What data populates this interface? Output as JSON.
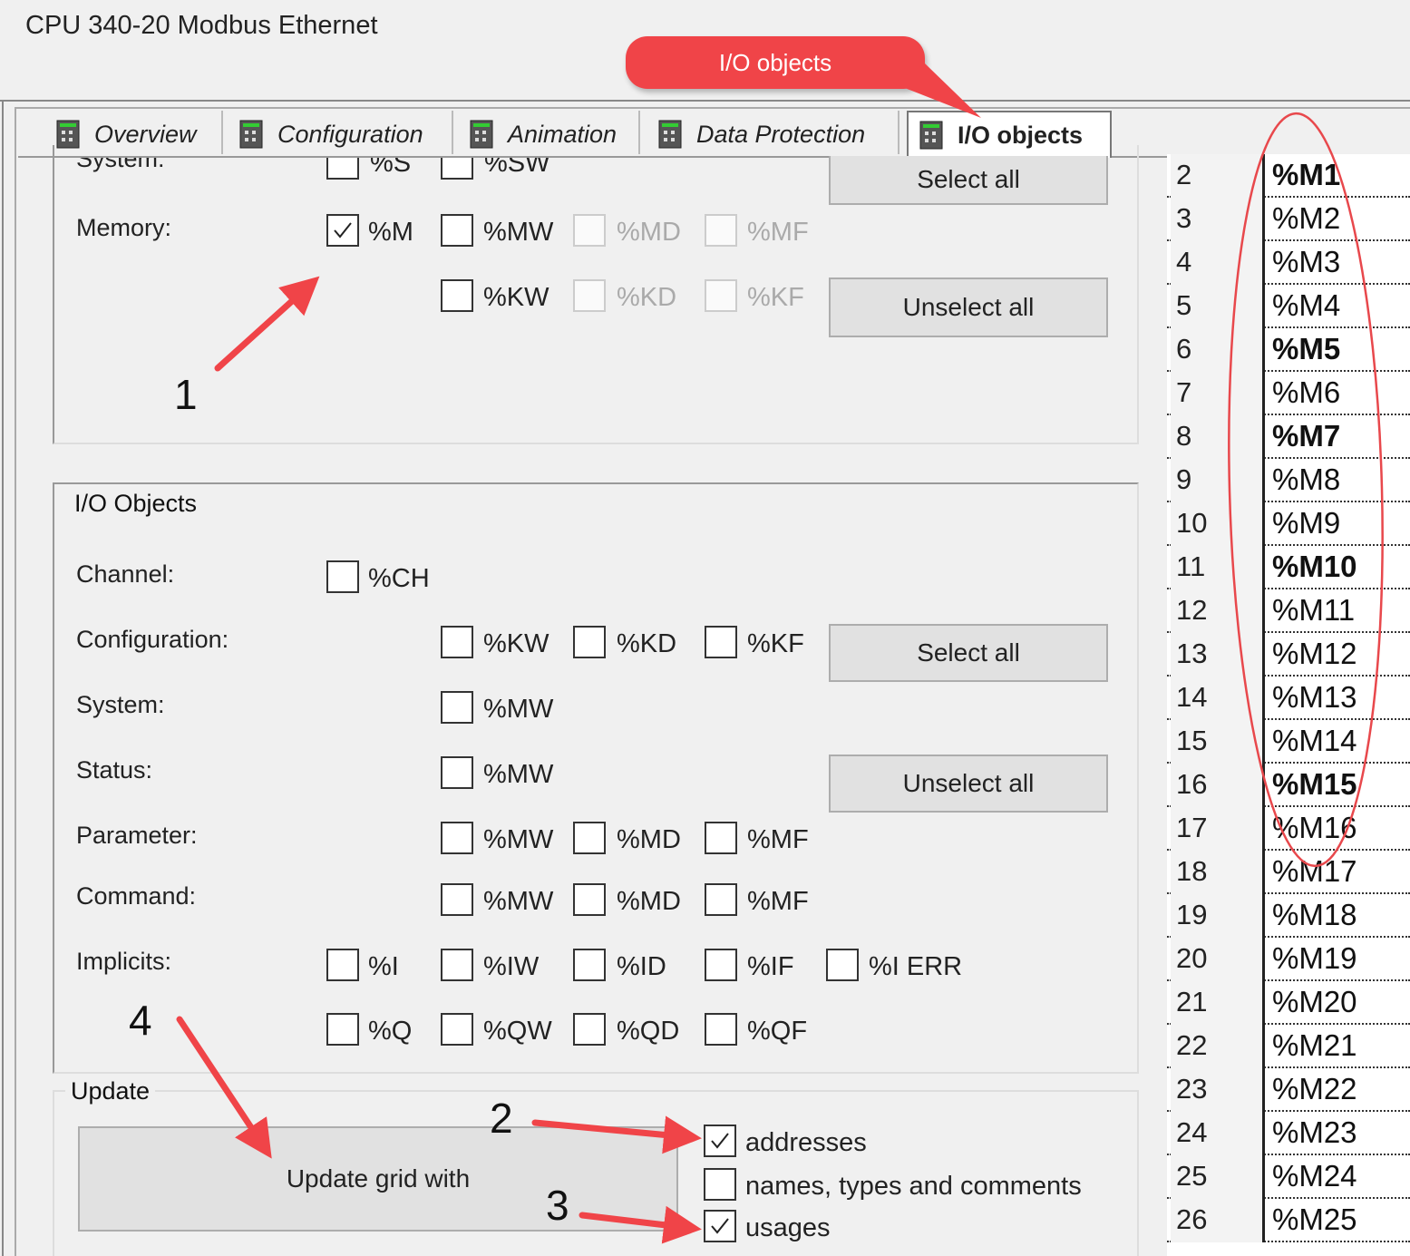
{
  "window": {
    "title": "CPU 340-20 Modbus Ethernet"
  },
  "tabs": [
    {
      "label": "Overview",
      "active": false
    },
    {
      "label": "Configuration",
      "active": false
    },
    {
      "label": "Animation",
      "active": false
    },
    {
      "label": "Data Protection",
      "active": false
    },
    {
      "label": "I/O objects",
      "active": true
    }
  ],
  "callout": {
    "text": "I/O objects"
  },
  "memory_group": {
    "system_label": "System:",
    "system_items": [
      {
        "label": "%S",
        "checked": false
      },
      {
        "label": "%SW",
        "checked": false
      }
    ],
    "memory_label": "Memory:",
    "memory_items": [
      {
        "label": "%M",
        "checked": true,
        "enabled": true
      },
      {
        "label": "%MW",
        "checked": false,
        "enabled": true
      },
      {
        "label": "%MD",
        "checked": false,
        "enabled": false
      },
      {
        "label": "%MF",
        "checked": false,
        "enabled": false
      },
      {
        "label": "%KW",
        "checked": false,
        "enabled": true
      },
      {
        "label": "%KD",
        "checked": false,
        "enabled": false
      },
      {
        "label": "%KF",
        "checked": false,
        "enabled": false
      }
    ],
    "select_all": "Select all",
    "unselect_all": "Unselect all"
  },
  "io_group": {
    "title": "I/O Objects",
    "rows": [
      {
        "label": "Channel:",
        "items": [
          "%CH"
        ]
      },
      {
        "label": "Configuration:",
        "items": [
          "%KW",
          "%KD",
          "%KF"
        ]
      },
      {
        "label": "System:",
        "items": [
          "%MW"
        ]
      },
      {
        "label": "Status:",
        "items": [
          "%MW"
        ]
      },
      {
        "label": "Parameter:",
        "items": [
          "%MW",
          "%MD",
          "%MF"
        ]
      },
      {
        "label": "Command:",
        "items": [
          "%MW",
          "%MD",
          "%MF"
        ]
      },
      {
        "label": "Implicits:",
        "items": [
          "%I",
          "%IW",
          "%ID",
          "%IF",
          "%I ERR"
        ]
      },
      {
        "label": "",
        "items": [
          "%Q",
          "%QW",
          "%QD",
          "%QF"
        ]
      }
    ],
    "select_all": "Select all",
    "unselect_all": "Unselect all"
  },
  "update_group": {
    "title": "Update",
    "button": "Update grid with",
    "options": [
      {
        "label": "addresses",
        "checked": true
      },
      {
        "label": "names, types and comments",
        "checked": false
      },
      {
        "label": "usages",
        "checked": true
      }
    ]
  },
  "grid": {
    "rows": [
      {
        "n": "2",
        "v": "%M1",
        "bold": true
      },
      {
        "n": "3",
        "v": "%M2",
        "bold": false
      },
      {
        "n": "4",
        "v": "%M3",
        "bold": false
      },
      {
        "n": "5",
        "v": "%M4",
        "bold": false
      },
      {
        "n": "6",
        "v": "%M5",
        "bold": true
      },
      {
        "n": "7",
        "v": "%M6",
        "bold": false
      },
      {
        "n": "8",
        "v": "%M7",
        "bold": true
      },
      {
        "n": "9",
        "v": "%M8",
        "bold": false
      },
      {
        "n": "10",
        "v": "%M9",
        "bold": false
      },
      {
        "n": "11",
        "v": "%M10",
        "bold": true
      },
      {
        "n": "12",
        "v": "%M11",
        "bold": false
      },
      {
        "n": "13",
        "v": "%M12",
        "bold": false
      },
      {
        "n": "14",
        "v": "%M13",
        "bold": false
      },
      {
        "n": "15",
        "v": "%M14",
        "bold": false
      },
      {
        "n": "16",
        "v": "%M15",
        "bold": true
      },
      {
        "n": "17",
        "v": "%M16",
        "bold": false
      },
      {
        "n": "18",
        "v": "%M17",
        "bold": false
      },
      {
        "n": "19",
        "v": "%M18",
        "bold": false
      },
      {
        "n": "20",
        "v": "%M19",
        "bold": false
      },
      {
        "n": "21",
        "v": "%M20",
        "bold": false
      },
      {
        "n": "22",
        "v": "%M21",
        "bold": false
      },
      {
        "n": "23",
        "v": "%M22",
        "bold": false
      },
      {
        "n": "24",
        "v": "%M23",
        "bold": false
      },
      {
        "n": "25",
        "v": "%M24",
        "bold": false
      },
      {
        "n": "26",
        "v": "%M25",
        "bold": false
      }
    ]
  },
  "annotations": {
    "n1": "1",
    "n2": "2",
    "n3": "3",
    "n4": "4",
    "color": "#f04448"
  }
}
